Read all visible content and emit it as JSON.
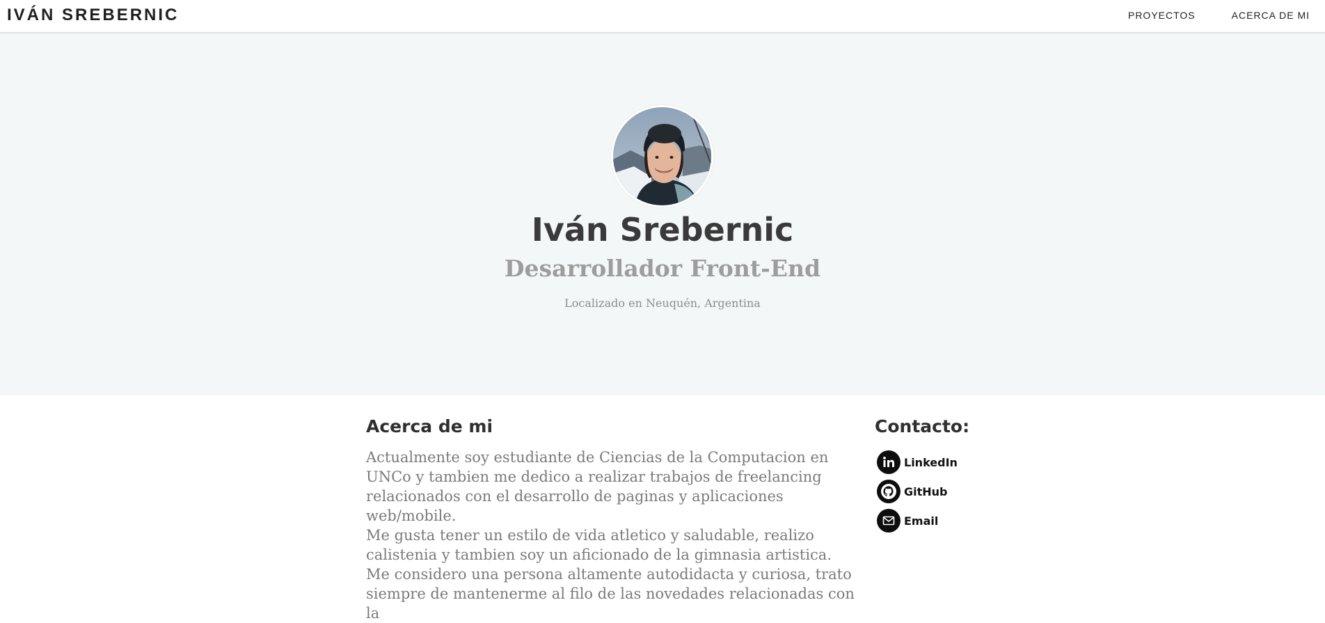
{
  "nav": {
    "brand": "IVÁN SREBERNIC",
    "links": [
      {
        "label": "PROYECTOS"
      },
      {
        "label": "ACERCA DE MI"
      }
    ]
  },
  "hero": {
    "name": "Iván Srebernic",
    "role": "Desarrollador Front-End",
    "location": "Localizado en Neuquén, Argentina"
  },
  "about": {
    "title": "Acerca de mi",
    "paragraphs": [
      "Actualmente soy estudiante de Ciencias de la Computacion en UNCo y tambien me dedico a realizar trabajos de freelancing relacionados con el desarrollo de paginas y aplicaciones web/mobile.",
      "Me gusta tener un estilo de vida atletico y saludable, realizo calistenia y tambien soy un aficionado de la gimnasia artistica.",
      "Me considero una persona altamente autodidacta y curiosa, trato siempre de mantenerme al filo de las novedades relacionadas con la"
    ]
  },
  "contact": {
    "title": "Contacto:",
    "items": [
      {
        "label": "LinkedIn",
        "icon": "linkedin-icon"
      },
      {
        "label": "GitHub",
        "icon": "github-icon"
      },
      {
        "label": "Email",
        "icon": "email-icon"
      }
    ]
  },
  "colors": {
    "hero_background": "#f3f7f7",
    "name_color": "#3a3a3a",
    "role_color": "#9d9d9d",
    "text_color": "#7a7a7a",
    "icon_background": "#0d0d0d"
  }
}
